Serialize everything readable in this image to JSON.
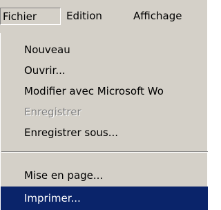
{
  "menubar": {
    "items": [
      {
        "label": "Fichier",
        "state": "pressed"
      },
      {
        "label": "Edition"
      },
      {
        "label": "Affichage"
      }
    ]
  },
  "menu": {
    "items": [
      {
        "label": "Nouveau",
        "enabled": true
      },
      {
        "label": "Ouvrir...",
        "enabled": true
      },
      {
        "label": "Modifier avec Microsoft Wo",
        "enabled": true
      },
      {
        "label": "Enregistrer",
        "enabled": false
      },
      {
        "label": "Enregistrer sous...",
        "enabled": true
      },
      {
        "label": "Mise en page...",
        "enabled": true
      },
      {
        "label": "Imprimer...",
        "enabled": true,
        "highlighted": true
      }
    ]
  },
  "colors": {
    "face": "#d4d0c8",
    "highlight": "#0a246a",
    "disabled_text": "#808080"
  }
}
